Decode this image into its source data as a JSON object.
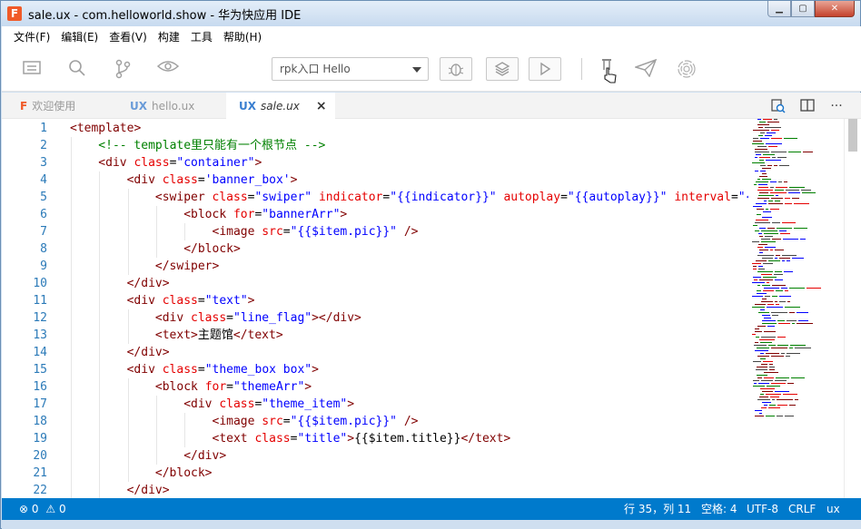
{
  "window": {
    "title": "sale.ux - com.helloworld.show - 华为快应用 IDE",
    "logo": "F"
  },
  "menu": [
    "文件(F)",
    "编辑(E)",
    "查看(V)",
    "构建",
    "工具",
    "帮助(H)"
  ],
  "toolbar": {
    "icons": [
      "explorer-icon",
      "search-icon",
      "git-branch-icon",
      "eye-icon",
      "bug-icon",
      "layers-icon",
      "play-icon",
      "flask-icon",
      "send-icon",
      "fingerprint-icon"
    ],
    "entry_select": "rpk入口 Hello"
  },
  "tabs": [
    {
      "icon": "F",
      "label": "欢迎使用",
      "active": false
    },
    {
      "icon": "UX",
      "label": "hello.ux",
      "active": false
    },
    {
      "icon": "UX",
      "label": "sale.ux",
      "active": true,
      "close": "×"
    }
  ],
  "editor": {
    "lines": [
      {
        "n": "1",
        "indent": 0,
        "tokens": [
          [
            "t",
            "<template>"
          ]
        ]
      },
      {
        "n": "2",
        "indent": 1,
        "tokens": [
          [
            "c",
            "<!-- template里只能有一个根节点 -->"
          ]
        ]
      },
      {
        "n": "3",
        "indent": 1,
        "tokens": [
          [
            "t",
            "<div "
          ],
          [
            "a",
            "class"
          ],
          [
            "p",
            "="
          ],
          [
            "s",
            "\"container\""
          ],
          [
            "t",
            ">"
          ]
        ]
      },
      {
        "n": "4",
        "indent": 2,
        "tokens": [
          [
            "t",
            "<div "
          ],
          [
            "a",
            "class"
          ],
          [
            "p",
            "="
          ],
          [
            "s",
            "'banner_box'"
          ],
          [
            "t",
            ">"
          ]
        ]
      },
      {
        "n": "5",
        "indent": 3,
        "tokens": [
          [
            "t",
            "<swiper "
          ],
          [
            "a",
            "class"
          ],
          [
            "p",
            "="
          ],
          [
            "s",
            "\"swiper\""
          ],
          [
            "p",
            " "
          ],
          [
            "a",
            "indicator"
          ],
          [
            "p",
            "="
          ],
          [
            "s",
            "\"{{indicator}}\""
          ],
          [
            "p",
            " "
          ],
          [
            "a",
            "autoplay"
          ],
          [
            "p",
            "="
          ],
          [
            "s",
            "\"{{autoplay}}\""
          ],
          [
            "p",
            " "
          ],
          [
            "a",
            "interval"
          ],
          [
            "p",
            "="
          ],
          [
            "s",
            "\"{{i"
          ]
        ]
      },
      {
        "n": "6",
        "indent": 4,
        "tokens": [
          [
            "t",
            "<block "
          ],
          [
            "a",
            "for"
          ],
          [
            "p",
            "="
          ],
          [
            "s",
            "\"bannerArr\""
          ],
          [
            "t",
            ">"
          ]
        ]
      },
      {
        "n": "7",
        "indent": 5,
        "tokens": [
          [
            "t",
            "<image "
          ],
          [
            "a",
            "src"
          ],
          [
            "p",
            "="
          ],
          [
            "s",
            "\"{{$item.pic}}\""
          ],
          [
            "p",
            " "
          ],
          [
            "t",
            "/>"
          ]
        ]
      },
      {
        "n": "8",
        "indent": 4,
        "tokens": [
          [
            "t",
            "</block>"
          ]
        ]
      },
      {
        "n": "9",
        "indent": 3,
        "tokens": [
          [
            "t",
            "</swiper>"
          ]
        ]
      },
      {
        "n": "10",
        "indent": 2,
        "tokens": [
          [
            "t",
            "</div>"
          ]
        ]
      },
      {
        "n": "11",
        "indent": 2,
        "tokens": [
          [
            "t",
            "<div "
          ],
          [
            "a",
            "class"
          ],
          [
            "p",
            "="
          ],
          [
            "s",
            "\"text\""
          ],
          [
            "t",
            ">"
          ]
        ]
      },
      {
        "n": "12",
        "indent": 3,
        "tokens": [
          [
            "t",
            "<div "
          ],
          [
            "a",
            "class"
          ],
          [
            "p",
            "="
          ],
          [
            "s",
            "\"line_flag\""
          ],
          [
            "t",
            ">"
          ],
          [
            "t",
            "</div>"
          ]
        ]
      },
      {
        "n": "13",
        "indent": 3,
        "tokens": [
          [
            "t",
            "<text>"
          ],
          [
            "p",
            "主题馆"
          ],
          [
            "t",
            "</text>"
          ]
        ]
      },
      {
        "n": "14",
        "indent": 2,
        "tokens": [
          [
            "t",
            "</div>"
          ]
        ]
      },
      {
        "n": "15",
        "indent": 2,
        "tokens": [
          [
            "t",
            "<div "
          ],
          [
            "a",
            "class"
          ],
          [
            "p",
            "="
          ],
          [
            "s",
            "\"theme_box box\""
          ],
          [
            "t",
            ">"
          ]
        ]
      },
      {
        "n": "16",
        "indent": 3,
        "tokens": [
          [
            "t",
            "<block "
          ],
          [
            "a",
            "for"
          ],
          [
            "p",
            "="
          ],
          [
            "s",
            "\"themeArr\""
          ],
          [
            "t",
            ">"
          ]
        ]
      },
      {
        "n": "17",
        "indent": 4,
        "tokens": [
          [
            "t",
            "<div "
          ],
          [
            "a",
            "class"
          ],
          [
            "p",
            "="
          ],
          [
            "s",
            "\"theme_item\""
          ],
          [
            "t",
            ">"
          ]
        ]
      },
      {
        "n": "18",
        "indent": 5,
        "tokens": [
          [
            "t",
            "<image "
          ],
          [
            "a",
            "src"
          ],
          [
            "p",
            "="
          ],
          [
            "s",
            "\"{{$item.pic}}\""
          ],
          [
            "p",
            " "
          ],
          [
            "t",
            "/>"
          ]
        ]
      },
      {
        "n": "19",
        "indent": 5,
        "tokens": [
          [
            "t",
            "<text "
          ],
          [
            "a",
            "class"
          ],
          [
            "p",
            "="
          ],
          [
            "s",
            "\"title\""
          ],
          [
            "t",
            ">"
          ],
          [
            "p",
            "{{$item.title}}"
          ],
          [
            "t",
            "</text>"
          ]
        ]
      },
      {
        "n": "20",
        "indent": 4,
        "tokens": [
          [
            "t",
            "</div>"
          ]
        ]
      },
      {
        "n": "21",
        "indent": 3,
        "tokens": [
          [
            "t",
            "</block>"
          ]
        ]
      },
      {
        "n": "22",
        "indent": 2,
        "tokens": [
          [
            "t",
            "</div>"
          ]
        ]
      }
    ]
  },
  "status": {
    "errors": "0",
    "warnings": "0",
    "cursor": "行 35，列 11",
    "spaces": "空格: 4",
    "encoding": "UTF-8",
    "eol": "CRLF",
    "language": "ux"
  },
  "colors": {
    "accent": "#007acc",
    "tag": "#800000",
    "attr": "#e50000",
    "string": "#0000ff",
    "comment": "#008000",
    "line_number": "#2b7ab8"
  }
}
